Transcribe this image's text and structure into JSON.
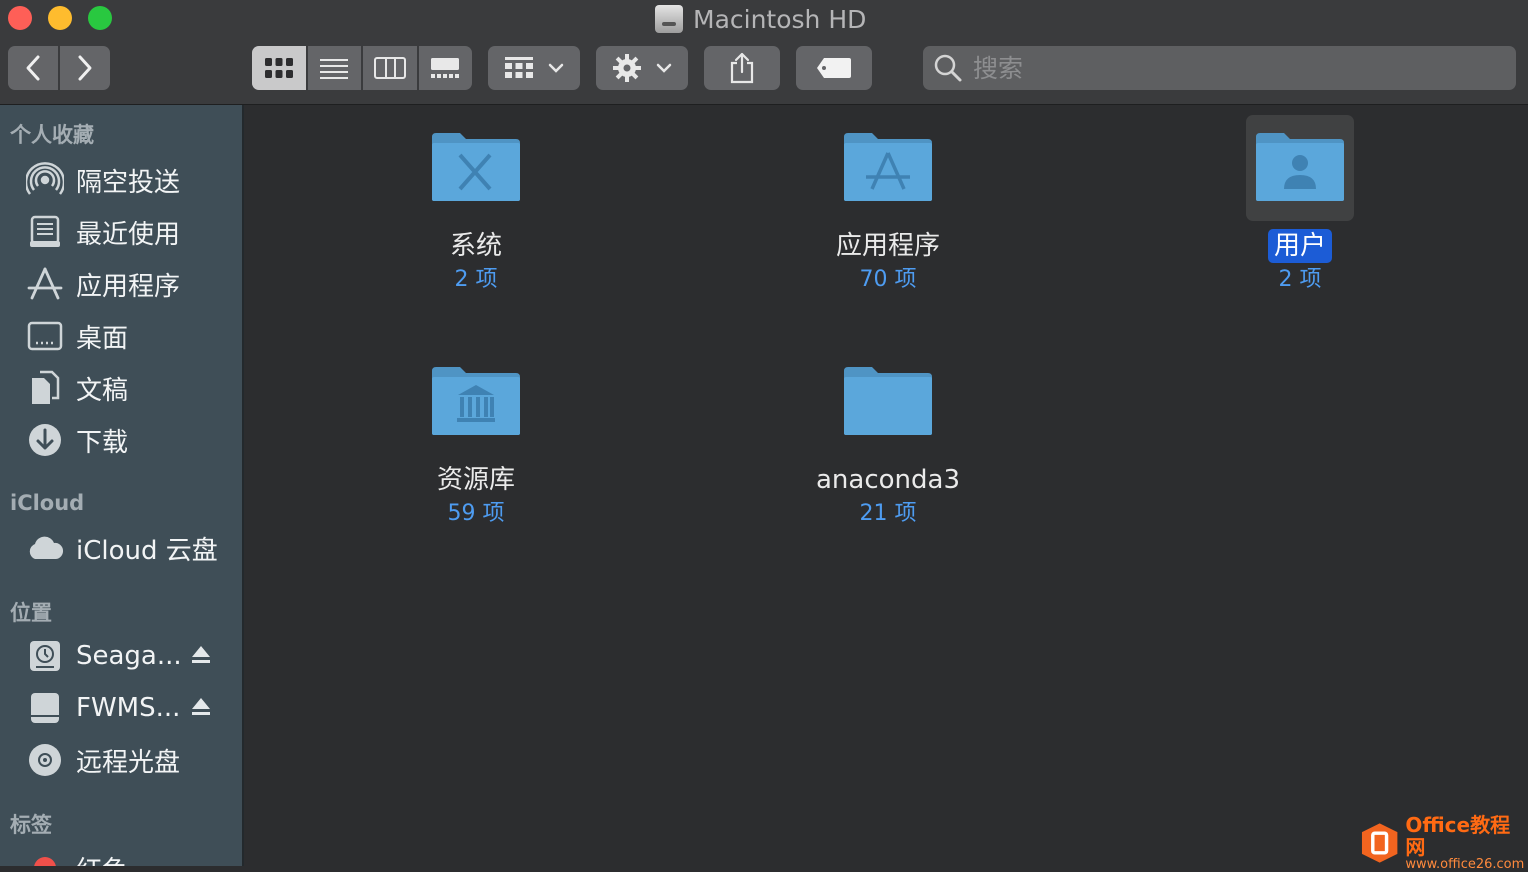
{
  "window": {
    "title": "Macintosh HD",
    "title_icon": "hard-disk-icon"
  },
  "toolbar": {
    "back_icon": "chevron-left-icon",
    "forward_icon": "chevron-right-icon",
    "view_modes": [
      {
        "icon": "icon-view-icon",
        "active": true
      },
      {
        "icon": "list-view-icon",
        "active": false
      },
      {
        "icon": "column-view-icon",
        "active": false
      },
      {
        "icon": "gallery-view-icon",
        "active": false
      }
    ],
    "group_icon": "group-grid-icon",
    "action_icon": "gear-icon",
    "share_icon": "share-icon",
    "tag_icon": "tag-icon",
    "search_placeholder": "搜索"
  },
  "sidebar": {
    "favorites_header": "个人收藏",
    "favorites": [
      {
        "label": "隔空投送",
        "icon": "airdrop-icon"
      },
      {
        "label": "最近使用",
        "icon": "recents-icon"
      },
      {
        "label": "应用程序",
        "icon": "applications-icon"
      },
      {
        "label": "桌面",
        "icon": "desktop-icon"
      },
      {
        "label": "文稿",
        "icon": "documents-icon"
      },
      {
        "label": "下载",
        "icon": "downloads-icon"
      }
    ],
    "icloud_header": "iCloud",
    "icloud": [
      {
        "label": "iCloud 云盘",
        "icon": "cloud-icon"
      }
    ],
    "locations_header": "位置",
    "locations": [
      {
        "label": "Seaga...",
        "icon": "time-machine-disk-icon",
        "eject": true
      },
      {
        "label": "FWMS...",
        "icon": "external-disk-icon",
        "eject": true
      },
      {
        "label": "远程光盘",
        "icon": "remote-disc-icon",
        "eject": false
      }
    ],
    "tags_header": "标签",
    "tags": [
      {
        "label": "红色",
        "color": "#f0504a"
      }
    ]
  },
  "content": {
    "items": [
      {
        "name": "系统",
        "count": "2 项",
        "icon": "system-folder-icon",
        "selected": false
      },
      {
        "name": "应用程序",
        "count": "70 项",
        "icon": "applications-folder-icon",
        "selected": false
      },
      {
        "name": "用户",
        "count": "2 项",
        "icon": "users-folder-icon",
        "selected": true
      },
      {
        "name": "资源库",
        "count": "59 项",
        "icon": "library-folder-icon",
        "selected": false
      },
      {
        "name": "anaconda3",
        "count": "21 项",
        "icon": "folder-icon",
        "selected": false
      }
    ]
  },
  "watermark": {
    "title": "Office教程网",
    "url": "www.office26.com"
  },
  "colors": {
    "accent": "#1c5cd6",
    "count_text": "#4e9cf1",
    "folder": "#5ba7db"
  }
}
